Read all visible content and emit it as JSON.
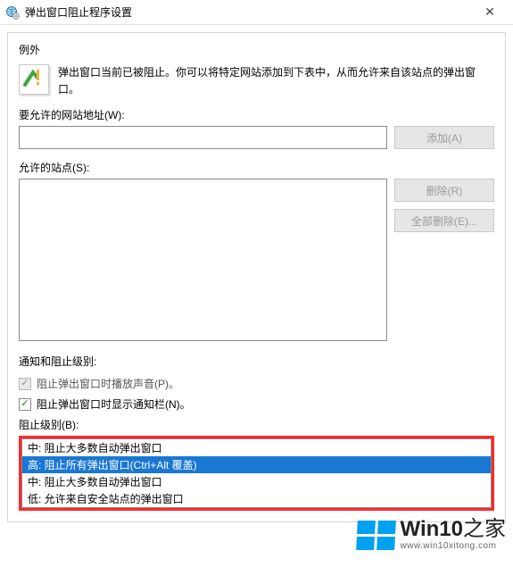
{
  "window": {
    "title": "弹出窗口阻止程序设置",
    "close_glyph": "✕"
  },
  "exceptions": {
    "group_label": "例外",
    "intro": "弹出窗口当前已被阻止。你可以将特定网站添加到下表中，从而允许来自该站点的弹出窗口。",
    "address_label": "要允许的网站地址(W):",
    "address_value": "",
    "add_btn": "添加(A)",
    "allowed_label": "允许的站点(S):",
    "remove_btn": "删除(R)",
    "remove_all_btn": "全部删除(E)..."
  },
  "notify": {
    "group_label": "通知和阻止级别:",
    "sound_label": "阻止弹出窗口时播放声音(P)。",
    "sound_checked": true,
    "sound_locked": true,
    "bar_label": "阻止弹出窗口时显示通知栏(N)。",
    "bar_checked": true,
    "level_label": "阻止级别(B):"
  },
  "level_options": [
    {
      "text": "中: 阻止大多数自动弹出窗口",
      "selected": false
    },
    {
      "text": "高: 阻止所有弹出窗口(Ctrl+Alt 覆盖)",
      "selected": true
    },
    {
      "text": "中: 阻止大多数自动弹出窗口",
      "selected": false
    },
    {
      "text": "低: 允许来自安全站点的弹出窗口",
      "selected": false
    }
  ],
  "watermark": {
    "brand_a": "Win10",
    "brand_b": "之家",
    "url": "www.win10xitong.com"
  }
}
